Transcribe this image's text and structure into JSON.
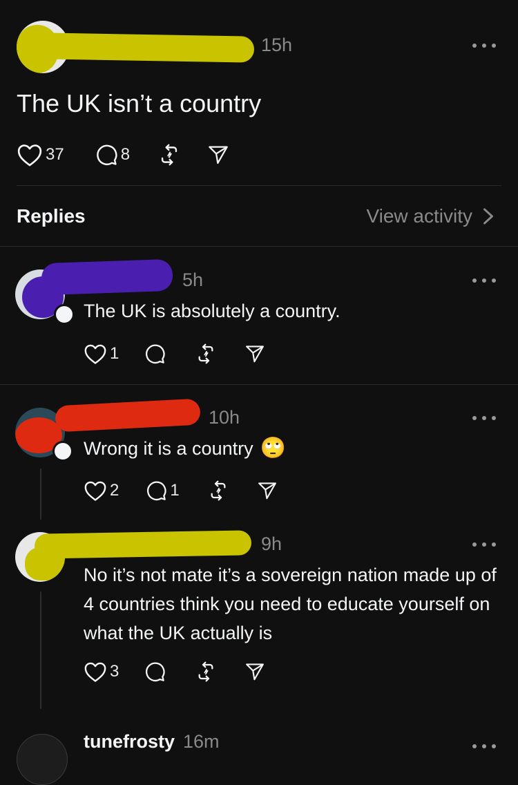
{
  "colors": {
    "background": "#101010",
    "text_primary": "#f3f5f7",
    "text_secondary": "#8a8a8a",
    "redaction_yellow": "#c9c300",
    "redaction_purple": "#4a1fb0",
    "redaction_red": "#dd2a10"
  },
  "main_post": {
    "time": "15h",
    "text": "The UK isn’t a country",
    "likes": "37",
    "replies": "8"
  },
  "replies_header": {
    "label": "Replies",
    "view_activity": "View activity"
  },
  "replies": [
    {
      "time": "5h",
      "text": "The UK is absolutely a country.",
      "likes": "1",
      "replies": ""
    },
    {
      "time": "10h",
      "text": "Wrong it is a country",
      "emoji": "🙄",
      "likes": "2",
      "replies": "1"
    },
    {
      "time": "9h",
      "text": "No it’s not mate it’s a sovereign nation made up of 4 countries think you need to educate yourself on what the UK actually is",
      "likes": "3",
      "replies": ""
    }
  ],
  "next_reply": {
    "username": "tunefrosty",
    "time": "16m"
  },
  "icons": {
    "like": "heart-icon",
    "reply": "comment-icon",
    "repost": "repost-icon",
    "share": "send-icon",
    "more": "more-options-icon",
    "chevron": "chevron-right-icon"
  }
}
